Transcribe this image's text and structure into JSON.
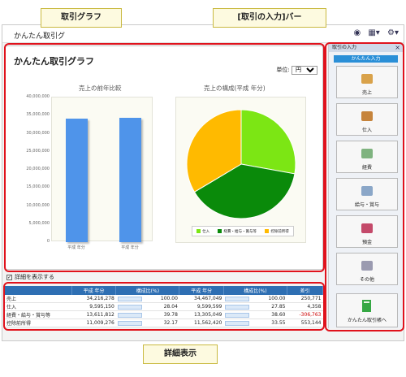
{
  "app": {
    "title": "かんたん取引グ"
  },
  "graph": {
    "title": "かんたん取引グラフ",
    "unit_label": "単位:",
    "unit_value": "円",
    "bar_chart_title": "売上の前年比較",
    "pie_chart_title": "売上の構成(平成 年分)"
  },
  "chart_data": [
    {
      "type": "bar",
      "title": "売上の前年比較",
      "categories": [
        "平成 年分",
        "平成 年分"
      ],
      "values": [
        34216278,
        34467049
      ],
      "ylim": [
        0,
        40000000
      ],
      "yticks": [
        "40,000,000",
        "35,000,000",
        "30,000,000",
        "25,000,000",
        "20,000,000",
        "15,000,000",
        "10,000,000",
        "5,000,000",
        "0"
      ]
    },
    {
      "type": "pie",
      "title": "売上の構成(平成 年分)",
      "labels": [
        "仕入",
        "経費・給与・賞与等",
        "控除前所得"
      ],
      "values": [
        27.85,
        38.6,
        33.55
      ],
      "colors": [
        "#7ce614",
        "#0a8a0a",
        "#ffba00"
      ]
    }
  ],
  "toggle": {
    "label": "詳細を表示する",
    "checked": "✓"
  },
  "table": {
    "headers": [
      "",
      "平成 年分",
      "構成比(%)",
      "平成 年分",
      "構成比(%)",
      "差引"
    ],
    "rows": [
      [
        "売上",
        "34,216,278",
        "100.00",
        "34,467,049",
        "100.00",
        "250,771"
      ],
      [
        "仕入",
        "9,595,150",
        "28.04",
        "9,599,599",
        "27.85",
        "4,358"
      ],
      [
        "経費・給与・賞与等",
        "13,611,812",
        "39.78",
        "13,305,049",
        "38.60",
        "-306,763"
      ],
      [
        "控除前所得",
        "11,009,276",
        "32.17",
        "11,562,420",
        "33.55",
        "553,144"
      ]
    ]
  },
  "side": {
    "header": "取引の入力",
    "close": "×",
    "sub": "かんたん入力",
    "buttons": [
      "売上",
      "仕入",
      "経費",
      "給与・賞与",
      "預金",
      "その他"
    ],
    "bottom_button": "かんたん取引帳へ"
  },
  "annotations": {
    "graph": "取引グラフ",
    "input_bar": "[取引の入力]バー",
    "detail": "詳細表示"
  }
}
